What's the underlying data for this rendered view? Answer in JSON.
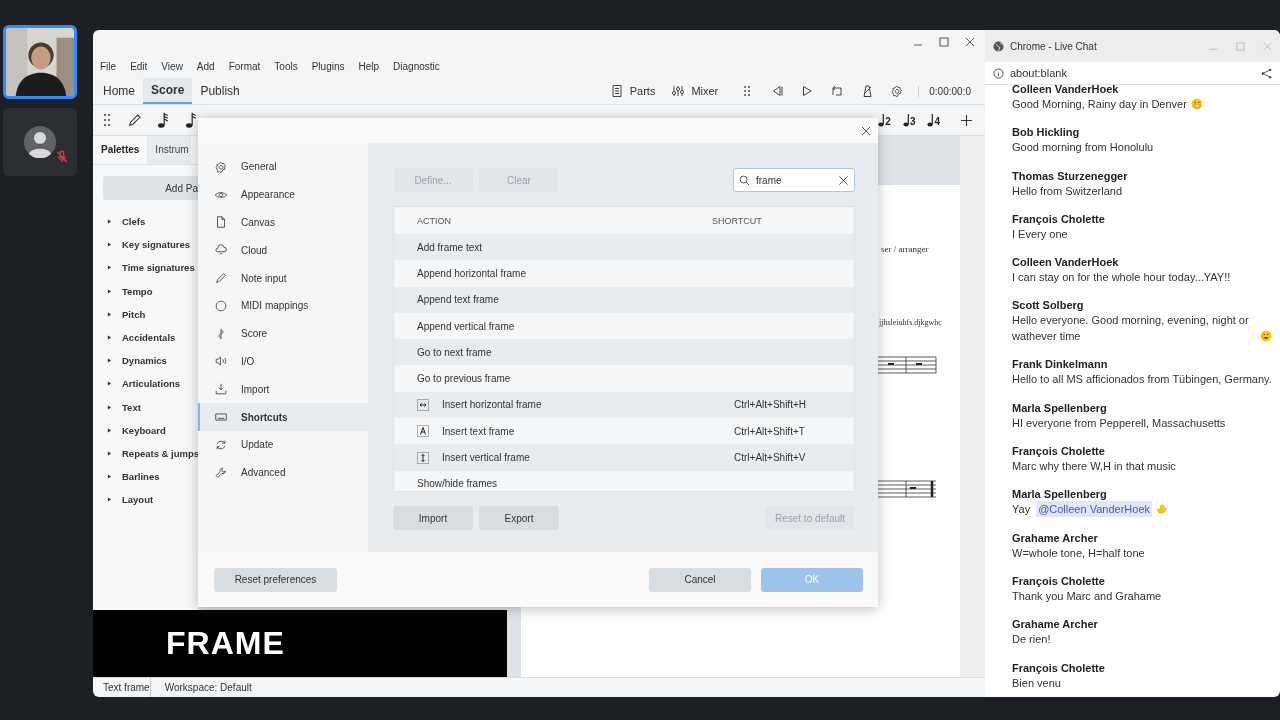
{
  "participants": [
    {
      "kind": "video",
      "selected": true
    },
    {
      "kind": "avatar",
      "selected": false,
      "muted": true
    }
  ],
  "app": {
    "menu": [
      "File",
      "Edit",
      "View",
      "Add",
      "Format",
      "Tools",
      "Plugins",
      "Help",
      "Diagnostic"
    ],
    "tabs": [
      {
        "label": "Home",
        "selected": false
      },
      {
        "label": "Score",
        "selected": true
      },
      {
        "label": "Publish",
        "selected": false
      }
    ],
    "toolbar": {
      "parts": "Parts",
      "mixer": "Mixer",
      "time": "0:00:00:0",
      "voices": [
        "2",
        "3",
        "4"
      ]
    },
    "palettes": {
      "tabs": [
        {
          "label": "Palettes",
          "selected": true
        },
        {
          "label": "Instrum",
          "selected": false
        }
      ],
      "add_button": "Add Pa",
      "items": [
        "Clefs",
        "Key signatures",
        "Time signatures",
        "Tempo",
        "Pitch",
        "Accidentals",
        "Dynamics",
        "Articulations",
        "Text",
        "Keyboard",
        "Repeats & jumps",
        "Barlines",
        "Layout"
      ]
    },
    "score_text": [
      "ser / arranger",
      "jjhsleiuhfs.djkgwhc"
    ],
    "status_bar": {
      "left": "Text frame",
      "workspace": "Workspace: Default"
    }
  },
  "preferences": {
    "nav": [
      {
        "label": "General",
        "selected": false
      },
      {
        "label": "Appearance",
        "selected": false
      },
      {
        "label": "Canvas",
        "selected": false
      },
      {
        "label": "Cloud",
        "selected": false
      },
      {
        "label": "Note input",
        "selected": false
      },
      {
        "label": "MIDI mappings",
        "selected": false
      },
      {
        "label": "Score",
        "selected": false
      },
      {
        "label": "I/O",
        "selected": false
      },
      {
        "label": "Import",
        "selected": false
      },
      {
        "label": "Shortcuts",
        "selected": true
      },
      {
        "label": "Update",
        "selected": false
      },
      {
        "label": "Advanced",
        "selected": false
      }
    ],
    "top_buttons": [
      {
        "label": "Define...",
        "disabled": true
      },
      {
        "label": "Clear",
        "disabled": true
      }
    ],
    "search": {
      "value": "frame"
    },
    "columns": [
      "ACTION",
      "SHORTCUT"
    ],
    "rows": [
      {
        "action": "Add frame text",
        "kind": "plain"
      },
      {
        "action": "Append horizontal frame",
        "kind": "plain"
      },
      {
        "action": "Append text frame",
        "kind": "plain"
      },
      {
        "action": "Append vertical frame",
        "kind": "plain"
      },
      {
        "action": "Go to next frame",
        "kind": "plain"
      },
      {
        "action": "Go to previous frame",
        "kind": "plain"
      },
      {
        "action": "Insert horizontal frame",
        "kind": "hframe",
        "shortcut": "Ctrl+Alt+Shift+H"
      },
      {
        "action": "Insert text frame",
        "kind": "tframe",
        "shortcut": "Ctrl+Alt+Shift+T"
      },
      {
        "action": "Insert vertical frame",
        "kind": "vframe",
        "shortcut": "Ctrl+Alt+Shift+V"
      },
      {
        "action": "Show/hide frames",
        "kind": "plain"
      }
    ],
    "bottom_buttons": [
      {
        "label": "Import",
        "disabled": false
      },
      {
        "label": "Export",
        "disabled": false
      }
    ],
    "reset_default": {
      "label": "Reset to default",
      "disabled": true
    },
    "reset_preferences": "Reset preferences",
    "cancel": "Cancel",
    "ok": "OK"
  },
  "caption": "FRAME",
  "chat": {
    "title": "Chrome - Live Chat",
    "address": "about:blank",
    "messages": [
      {
        "author": "Colleen VanderHoek",
        "text": "Good Morning, Rainy day in Denver",
        "kind": "grin"
      },
      {
        "author": "Bob Hickling",
        "text": "Good morning from Honolulu"
      },
      {
        "author": "Thomas Sturzenegger",
        "text": "Hello from Switzerland"
      },
      {
        "author": "François Cholette",
        "text": "I Every one"
      },
      {
        "author": "Colleen VanderHoek",
        "text": "I can stay on for the whole hour today...YAY!!"
      },
      {
        "author": "Scott Solberg",
        "text": "Hello everyone. Good morning, evening, night or wathever time",
        "kind": "smile"
      },
      {
        "author": "Frank Dinkelmann",
        "text": "Hello to all MS afficionados from Tübingen, Germany."
      },
      {
        "author": "Marla Spellenberg",
        "text": "HI everyone from Pepperell, Massachusetts"
      },
      {
        "author": "François Cholette",
        "text": "Marc why there W,H  in that music"
      },
      {
        "author": "Marla Spellenberg",
        "text": "Yay",
        "mention": "@Colleen VanderHoek",
        "kind": "wave"
      },
      {
        "author": "Grahame Archer",
        "text": "W=whole tone, H=half tone"
      },
      {
        "author": "François Cholette",
        "text": "Thank you Marc and Grahame"
      },
      {
        "author": "Grahame Archer",
        "text": "De rien!"
      },
      {
        "author": "François Cholette",
        "text": "Bien venu"
      }
    ]
  }
}
